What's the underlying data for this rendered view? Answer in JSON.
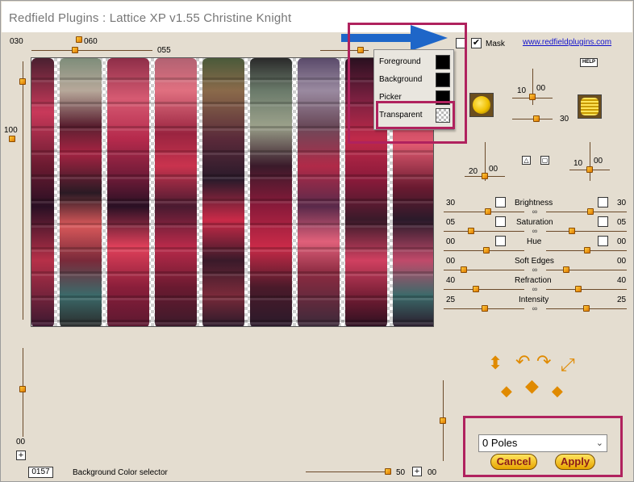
{
  "window": {
    "title": "Redfield Plugins : Lattice XP v1.55   Christine Knight"
  },
  "top_sliders": {
    "left_value": "030",
    "top_value": "060",
    "mid_value": "055"
  },
  "left_slider": {
    "top_label": "100",
    "bottom_label": "00"
  },
  "mask": {
    "label": "Mask",
    "checked": true
  },
  "link": {
    "text": "www.redfieldplugins.com"
  },
  "help_label": "HELP",
  "popup": {
    "items": [
      {
        "label": "Foreground",
        "swatch": "#000000"
      },
      {
        "label": "Background",
        "swatch": "#000000"
      },
      {
        "label": "Picker",
        "swatch": "#000000"
      },
      {
        "label": "Transparent",
        "swatch": "transparent"
      }
    ]
  },
  "right_params": {
    "light_top": "10",
    "light_top_r": "00",
    "light_bottom": "30",
    "angle_left_a": "20",
    "angle_left_b": "00",
    "angle_right_a": "10",
    "angle_right_b": "00"
  },
  "adjusters": [
    {
      "name": "Brightness",
      "left": "30",
      "right": "30"
    },
    {
      "name": "Saturation",
      "left": "05",
      "right": "05"
    },
    {
      "name": "Hue",
      "left": "00",
      "right": "00"
    },
    {
      "name": "Soft Edges",
      "left": "00",
      "right": "00"
    },
    {
      "name": "Refraction",
      "left": "40",
      "right": "40"
    },
    {
      "name": "Intensity",
      "left": "25",
      "right": "25"
    }
  ],
  "preset": {
    "selected": "0 Poles"
  },
  "buttons": {
    "cancel": "Cancel",
    "apply": "Apply"
  },
  "status": {
    "counter": "0157",
    "message": "Background Color selector",
    "zoom_value": "50",
    "zoom_right": "00"
  },
  "colors": {
    "highlight": "#b0225e",
    "arrow": "#1e66c8",
    "accent": "#e08a00"
  }
}
